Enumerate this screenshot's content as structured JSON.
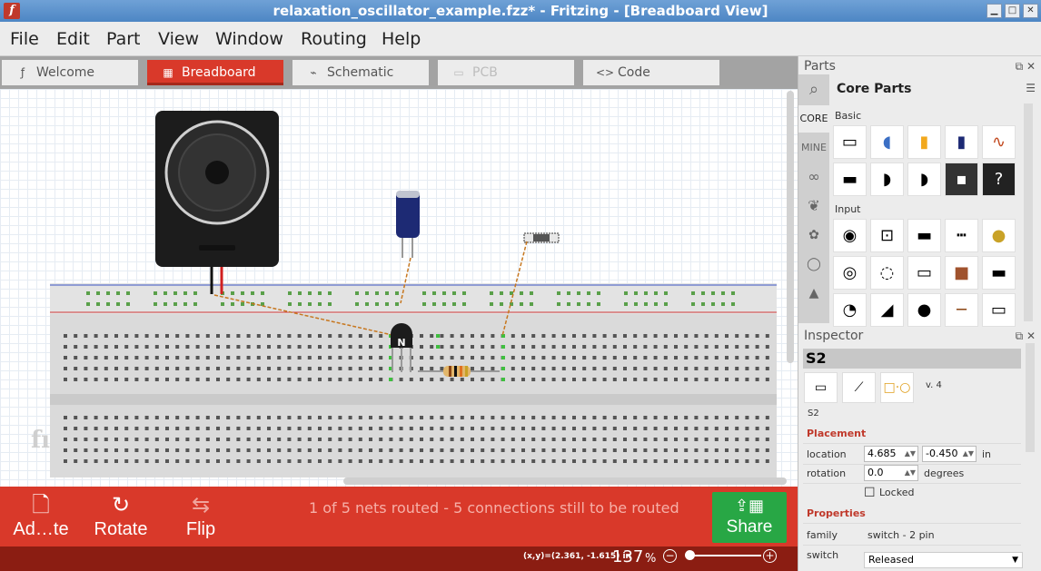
{
  "window": {
    "title": "relaxation_oscillator_example.fzz* - Fritzing - [Breadboard View]",
    "app_icon": "f"
  },
  "menu": [
    "File",
    "Edit",
    "Part",
    "View",
    "Window",
    "Routing",
    "Help"
  ],
  "tabs": [
    {
      "label": "Welcome",
      "icon": "fritzing-f-icon",
      "glyph": "ƒ",
      "state": "normal"
    },
    {
      "label": "Breadboard",
      "icon": "breadboard-icon",
      "glyph": "▦",
      "state": "active"
    },
    {
      "label": "Schematic",
      "icon": "schematic-icon",
      "glyph": "⌁",
      "state": "normal"
    },
    {
      "label": "PCB",
      "icon": "pcb-icon",
      "glyph": "▭",
      "state": "disabled"
    },
    {
      "label": "Code",
      "icon": "code-icon",
      "glyph": "<>",
      "state": "normal"
    }
  ],
  "canvas": {
    "watermark": "fı"
  },
  "toolbar": {
    "add_label": "Ad…te",
    "rotate_label": "Rotate",
    "flip_label": "Flip",
    "status_message": "1 of 5 nets routed - 5 connections still to be routed",
    "share_label": "Share"
  },
  "statusbar": {
    "coords": "(x,y)=(2.361, -1.615) in",
    "zoom_value": "137",
    "zoom_unit": "%",
    "zoom_out": "−",
    "zoom_in": "+"
  },
  "parts_panel": {
    "title": "Parts",
    "bin_title": "Core Parts",
    "bins": [
      "CORE",
      "MINE"
    ],
    "sections": [
      "Basic",
      "Input"
    ],
    "basic_parts": [
      "resistor",
      "ceramic-capacitor",
      "tantalum-capacitor",
      "electrolytic-capacitor",
      "inductor",
      "diode",
      "pnp-transistor",
      "npn-transistor",
      "ic",
      "mystery-part"
    ],
    "input_parts": [
      "potentiometer",
      "trimmer",
      "slide-potentiometer",
      "pin-header",
      "piezo",
      "rotary-encoder",
      "dip-switch",
      "slide-switch",
      "pushbutton",
      "toggle-switch",
      "light-sensor",
      "tilt-sensor",
      "microphone",
      "wire",
      "photocell"
    ]
  },
  "inspector": {
    "title": "Inspector",
    "part_name": "S2",
    "version": "v. 4",
    "part_title": "S2",
    "placement_heading": "Placement",
    "location_label": "location",
    "location_x": "4.685",
    "location_y": "-0.450",
    "location_unit": "in",
    "rotation_label": "rotation",
    "rotation_value": "0.0",
    "rotation_unit": "degrees",
    "locked_label": "Locked",
    "properties_heading": "Properties",
    "family_label": "family",
    "family_value": "switch - 2 pin",
    "switch_label": "switch",
    "switch_value": "Released"
  },
  "colors": {
    "accent": "#d9392a",
    "statusbar": "#8b1d12",
    "share": "#28a745",
    "titlebar": "#5b92cc"
  }
}
